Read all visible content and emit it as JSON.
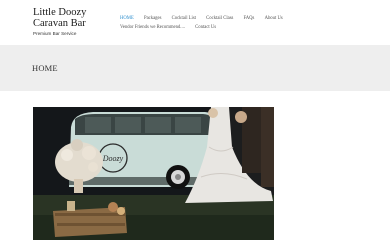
{
  "site": {
    "title": "Little Doozy Caravan Bar",
    "tagline": "Premium Bar Service"
  },
  "nav": {
    "items": [
      {
        "label": "HOME",
        "active": true
      },
      {
        "label": "Packages",
        "active": false
      },
      {
        "label": "Cocktail List",
        "active": false
      },
      {
        "label": "Cocktail Class",
        "active": false
      },
      {
        "label": "FAQs",
        "active": false
      },
      {
        "label": "About Us",
        "active": false
      },
      {
        "label": "Vendor Friends we Recommend....",
        "active": false
      },
      {
        "label": "Contact Us",
        "active": false
      }
    ]
  },
  "page": {
    "heading": "HOME"
  },
  "hero": {
    "caravan_logo_text": "Doozy"
  },
  "colors": {
    "accent": "#2f8fce",
    "banner_bg": "#eeeeee",
    "text": "#1b1b1b"
  }
}
